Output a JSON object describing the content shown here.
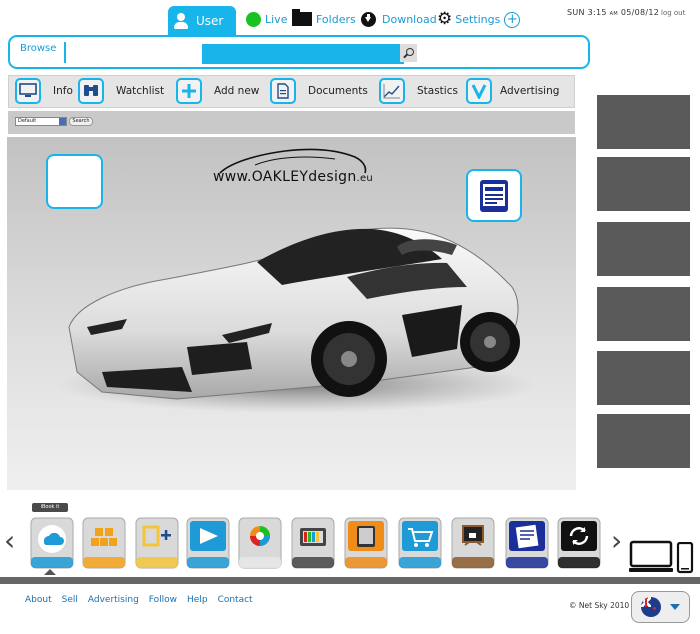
{
  "header": {
    "user_tab": "User",
    "nav": {
      "live": "Live",
      "folders": "Folders",
      "download": "Download",
      "settings": "Settings"
    },
    "datetime_day": "SUN 3:15",
    "datetime_ampm": "AM",
    "datetime_date": "05/08/12",
    "logout": "log out"
  },
  "browse": {
    "label": "Browse",
    "search_value": ""
  },
  "toolbar": {
    "items": [
      {
        "label": "Info",
        "icon": "monitor-icon"
      },
      {
        "label": "Watchlist",
        "icon": "binoculars-icon"
      },
      {
        "label": "Add new",
        "icon": "plus-icon"
      },
      {
        "label": "Documents",
        "icon": "document-icon"
      },
      {
        "label": "Stastics",
        "icon": "chart-icon"
      },
      {
        "label": "Advertising",
        "icon": "v-icon"
      }
    ]
  },
  "filter": {
    "selected": "Default",
    "button": "Search"
  },
  "hero": {
    "logo_main": "www.OAKLEYdesign",
    "logo_tld": ".eu"
  },
  "dock": {
    "tooltip": "iBook it",
    "apps": [
      {
        "name": "cloud-app-icon",
        "color": "#1e9ad6"
      },
      {
        "name": "boxes-app-icon",
        "color": "#f3a21b"
      },
      {
        "name": "b-plus-app-icon",
        "color": "#f3c53b"
      },
      {
        "name": "play-app-icon",
        "color": "#1e9ad6"
      },
      {
        "name": "color-wheel-app-icon",
        "color": "#e8e8e8"
      },
      {
        "name": "tv-app-icon",
        "color": "#444444"
      },
      {
        "name": "tablet-app-icon",
        "color": "#f08c1a"
      },
      {
        "name": "cart-app-icon",
        "color": "#1e9ad6"
      },
      {
        "name": "blackboard-app-icon",
        "color": "#8b5a2b"
      },
      {
        "name": "notes-app-icon",
        "color": "#1b2f9a"
      },
      {
        "name": "sync-app-icon",
        "color": "#111111"
      }
    ]
  },
  "footer": {
    "links": [
      "About",
      "Sell",
      "Advertising",
      "Follow",
      "Help",
      "Contact"
    ],
    "copyright": "Net Sky 2010"
  },
  "colors": {
    "accent": "#18b5ea",
    "link": "#1b6fb0",
    "panel": "#5a5a5a"
  }
}
